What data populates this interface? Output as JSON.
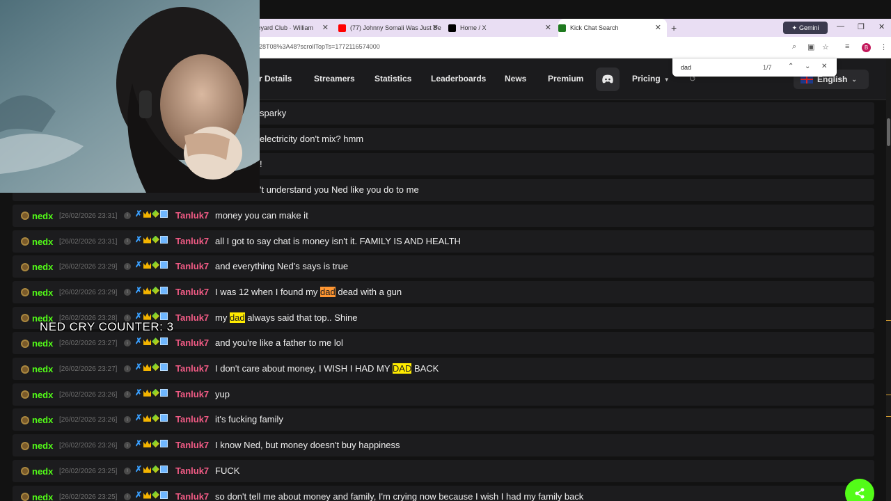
{
  "browser": {
    "tabs": [
      {
        "label": "aveyard Club · William",
        "close": "✕"
      },
      {
        "label": "(77) Johnny Somali Was Just De",
        "close": "✕"
      },
      {
        "label": "Home / X",
        "close": "✕"
      },
      {
        "label": "Kick Chat Search",
        "close": "✕"
      }
    ],
    "new_tab": "+",
    "gemini_label": "Gemini",
    "url": "28T08%3A48?scrollTopTs=1772116574000",
    "profile_initial": "B"
  },
  "find": {
    "query": "dad",
    "count": "1/7",
    "up": "⌃",
    "down": "⌄",
    "close": "✕"
  },
  "nav": {
    "items": [
      "r Details",
      "Streamers",
      "Statistics",
      "Leaderboards",
      "News",
      "Premium"
    ],
    "pricing": "Pricing",
    "language": "English"
  },
  "overlay": {
    "counter_text": "NED CRY COUNTER: 3"
  },
  "chat": {
    "partial_rows": [
      "sparky",
      "electricity don't mix? hmm",
      "!",
      "'t understand you Ned like you do to me"
    ],
    "rows": [
      {
        "channel": "nedx",
        "ts": "[26/02/2026 23:31]",
        "user": "Tanluk7",
        "parts": [
          {
            "t": "money you can make it"
          }
        ]
      },
      {
        "channel": "nedx",
        "ts": "[26/02/2026 23:31]",
        "user": "Tanluk7",
        "parts": [
          {
            "t": "all I got to say chat is money isn't it. FAMILY IS AND HEALTH"
          }
        ]
      },
      {
        "channel": "nedx",
        "ts": "[26/02/2026 23:29]",
        "user": "Tanluk7",
        "parts": [
          {
            "t": "and everything Ned's says is true"
          }
        ]
      },
      {
        "channel": "nedx",
        "ts": "[26/02/2026 23:29]",
        "user": "Tanluk7",
        "parts": [
          {
            "t": "I was 12 when I found my "
          },
          {
            "t": "dad",
            "hl": "o"
          },
          {
            "t": " dead with a gun"
          }
        ]
      },
      {
        "channel": "nedx",
        "ts": "[26/02/2026 23:28]",
        "user": "Tanluk7",
        "parts": [
          {
            "t": "my "
          },
          {
            "t": "dad",
            "hl": "y"
          },
          {
            "t": " always said that top.. Shine"
          }
        ]
      },
      {
        "channel": "nedx",
        "ts": "[26/02/2026 23:27]",
        "user": "Tanluk7",
        "parts": [
          {
            "t": "and you're like a father to me lol"
          }
        ]
      },
      {
        "channel": "nedx",
        "ts": "[26/02/2026 23:27]",
        "user": "Tanluk7",
        "parts": [
          {
            "t": "I don't care about money, I WISH I HAD MY "
          },
          {
            "t": "DAD",
            "hl": "y"
          },
          {
            "t": " BACK"
          }
        ]
      },
      {
        "channel": "nedx",
        "ts": "[26/02/2026 23:26]",
        "user": "Tanluk7",
        "parts": [
          {
            "t": "yup"
          }
        ]
      },
      {
        "channel": "nedx",
        "ts": "[26/02/2026 23:26]",
        "user": "Tanluk7",
        "parts": [
          {
            "t": "it's fucking family"
          }
        ]
      },
      {
        "channel": "nedx",
        "ts": "[26/02/2026 23:26]",
        "user": "Tanluk7",
        "parts": [
          {
            "t": "I know Ned, but money doesn't buy happiness"
          }
        ]
      },
      {
        "channel": "nedx",
        "ts": "[26/02/2026 23:25]",
        "user": "Tanluk7",
        "parts": [
          {
            "t": "FUCK"
          }
        ]
      },
      {
        "channel": "nedx",
        "ts": "[26/02/2026 23:25]",
        "user": "Tanluk7",
        "parts": [
          {
            "t": "so don't tell me about money and family, I'm crying now because I wish I had my family back"
          }
        ]
      }
    ]
  },
  "colors": {
    "channel": "#53fc18",
    "username": "#f25b85",
    "highlight_current": "#ff9632",
    "highlight": "#ffeb00"
  }
}
